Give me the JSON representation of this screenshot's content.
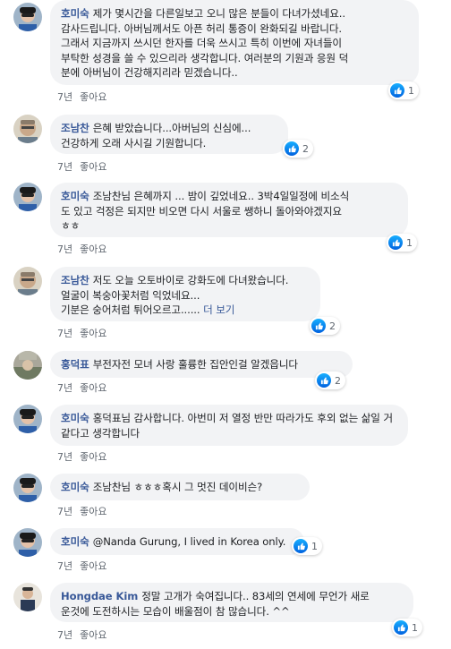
{
  "comments": [
    {
      "author": "호미숙",
      "text": "제가 몇시간을 다른일보고 오니 많은 분들이 다녀가셨네요..\n감사드립니다. 아버님께서도 아픈 허리 통증이 완화되길 바랍니다.\n그래서 지금까지 쓰시던 한자를 더욱 쓰시고 특히 이번에 자녀들이\n부탁한 성경을 쓸 수 있으리라 생각합니다. 여러분의 기원과 응원 덕\n분에 아버님이 건강해지리라 믿겠습니다..",
      "more": "",
      "time": "7년",
      "like": "좋아요",
      "reactions": "1"
    },
    {
      "author": "조남찬",
      "text": "은혜 받았습니다...아버님의 신심에...\n건강하게 오래 사시길 기원합니다.",
      "more": "",
      "time": "7년",
      "like": "좋아요",
      "reactions": "2"
    },
    {
      "author": "호미숙",
      "text": "조남찬님 은혜까지 ... 밤이 깊었네요.. 3박4일일정에 비소식\n도 있고 걱정은 되지만 비오면 다시 서울로 쌩하니 돌아와야겠지요\nㅎㅎ",
      "more": "",
      "time": "7년",
      "like": "좋아요",
      "reactions": "1"
    },
    {
      "author": "조남찬",
      "text": "저도 오늘 오토바이로 강화도에 다녀왔습니다.\n얼굴이 복숭아꽃처럼 익었네요...\n기분은 숭어처럼 튀어오르고...... ",
      "more": "더 보기",
      "time": "7년",
      "like": "좋아요",
      "reactions": "2"
    },
    {
      "author": "홍덕표",
      "text": "부전자전 모녀 사랑 훌륭한 집안인걸 알겠읍니다",
      "more": "",
      "time": "7년",
      "like": "좋아요",
      "reactions": "2"
    },
    {
      "author": "호미숙",
      "text": "홍덕표님 감사합니다. 아번미 저 열정 반만 따라가도 후외 없는 삶일 거 같다고 생각합니다",
      "more": "",
      "time": "7년",
      "like": "좋아요",
      "reactions": ""
    },
    {
      "author": "호미숙",
      "text": "조남찬님 ㅎㅎㅎ혹시 그 멋진 데이비슨?",
      "more": "",
      "time": "7년",
      "like": "좋아요",
      "reactions": ""
    },
    {
      "author": "호미숙",
      "text": "@Nanda Gurung, I lived in Korea only.",
      "more": "",
      "time": "7년",
      "like": "좋아요",
      "reactions": "1"
    },
    {
      "author": "Hongdae Kim",
      "text": "정말 고개가 숙여집니다.. 83세의 연세에 무언가 새로\n운것에 도전하시는 모습이 배울점이 참 많습니다. ^^",
      "more": "",
      "time": "7년",
      "like": "좋아요",
      "reactions": "1"
    }
  ],
  "colors": {
    "author": "#385898",
    "bubble": "#f2f3f5",
    "like": "#1877f2"
  }
}
